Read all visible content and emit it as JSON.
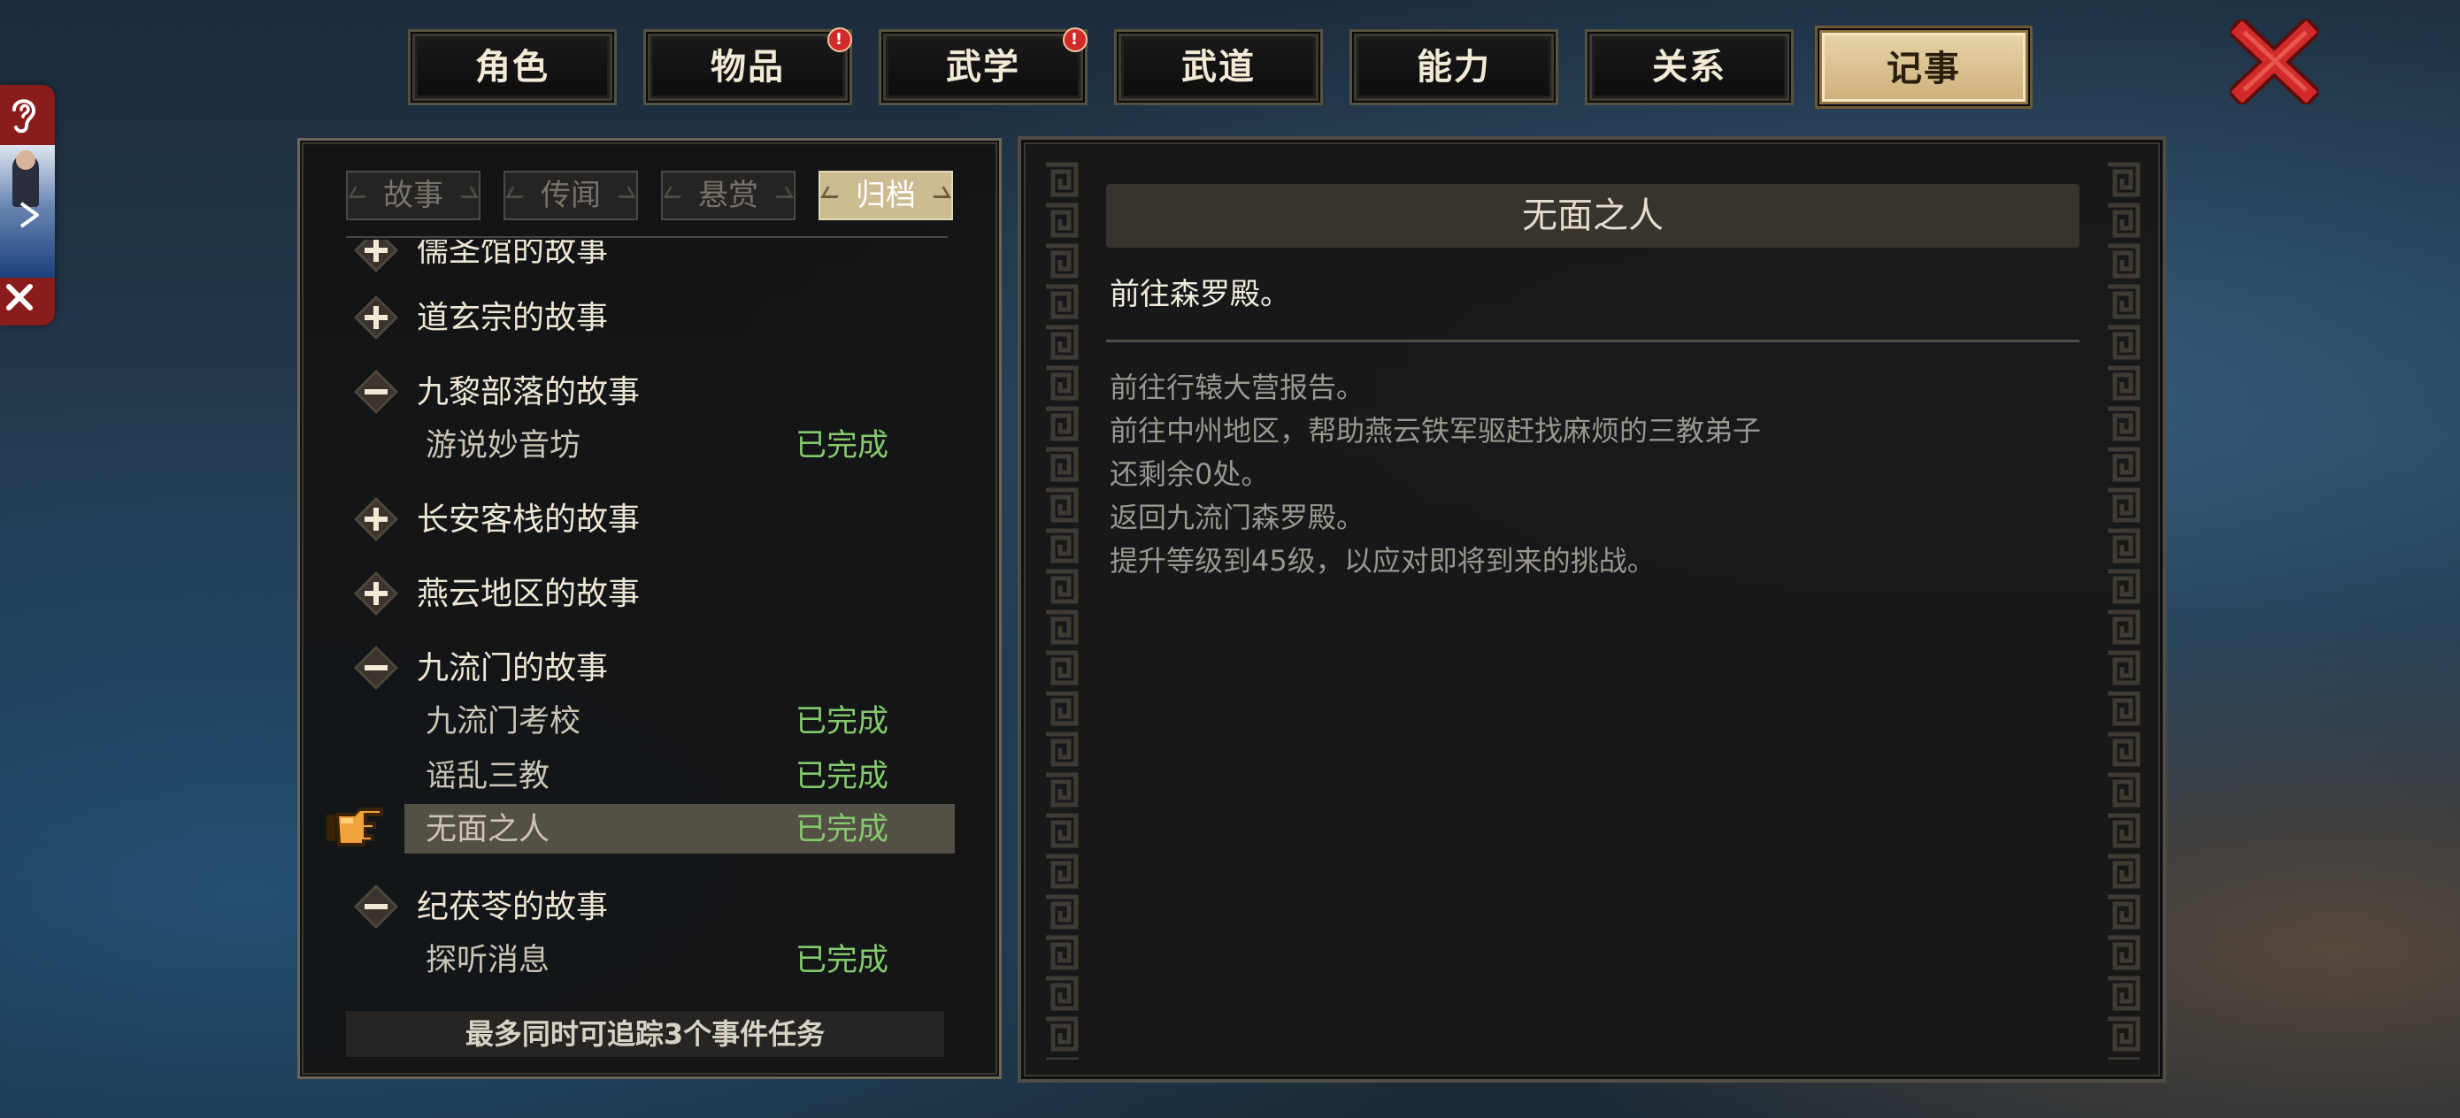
{
  "tabs": [
    {
      "label": "角色",
      "badge": false
    },
    {
      "label": "物品",
      "badge": true
    },
    {
      "label": "武学",
      "badge": true
    },
    {
      "label": "武道",
      "badge": false
    },
    {
      "label": "能力",
      "badge": false
    },
    {
      "label": "关系",
      "badge": false
    },
    {
      "label": "记事",
      "badge": false,
      "active": true
    }
  ],
  "badge_text": "!",
  "subtabs": [
    "故事",
    "传闻",
    "悬赏",
    "归档"
  ],
  "active_subtab": "归档",
  "quest_list": {
    "groups": [
      {
        "label": "儒圣馆的故事",
        "expanded": false
      },
      {
        "label": "道玄宗的故事",
        "expanded": false
      },
      {
        "label": "九黎部落的故事",
        "expanded": true
      },
      {
        "label": "长安客栈的故事",
        "expanded": false
      },
      {
        "label": "燕云地区的故事",
        "expanded": false
      },
      {
        "label": "九流门的故事",
        "expanded": true
      },
      {
        "label": "纪茯苓的故事",
        "expanded": true
      }
    ],
    "items": [
      {
        "label": "游说妙音坊",
        "status": "已完成"
      },
      {
        "label": "九流门考校",
        "status": "已完成"
      },
      {
        "label": "谣乱三教",
        "status": "已完成"
      },
      {
        "label": "无面之人",
        "status": "已完成",
        "selected": true
      },
      {
        "label": "探听消息",
        "status": "已完成"
      }
    ],
    "footer_note": "最多同时可追踪3个事件任务"
  },
  "detail": {
    "title": "无面之人",
    "goal": "前往森罗殿。",
    "log": [
      "前往行辕大营报告。",
      "前往中州地区，帮助燕云铁军驱赶找麻烦的三教弟子",
      "还剩余0处。",
      "返回九流门森罗殿。",
      "提升等级到45级，以应对即将到来的挑战。"
    ]
  },
  "side_widget": {
    "icons": [
      "ear-icon",
      "video-thumbnail",
      "play-icon",
      "close-icon"
    ]
  },
  "colors": {
    "accent_gold": "#cdb07a",
    "complete_green": "#84c96c",
    "close_red": "#d22a2a",
    "panel_bg": "#161616"
  }
}
